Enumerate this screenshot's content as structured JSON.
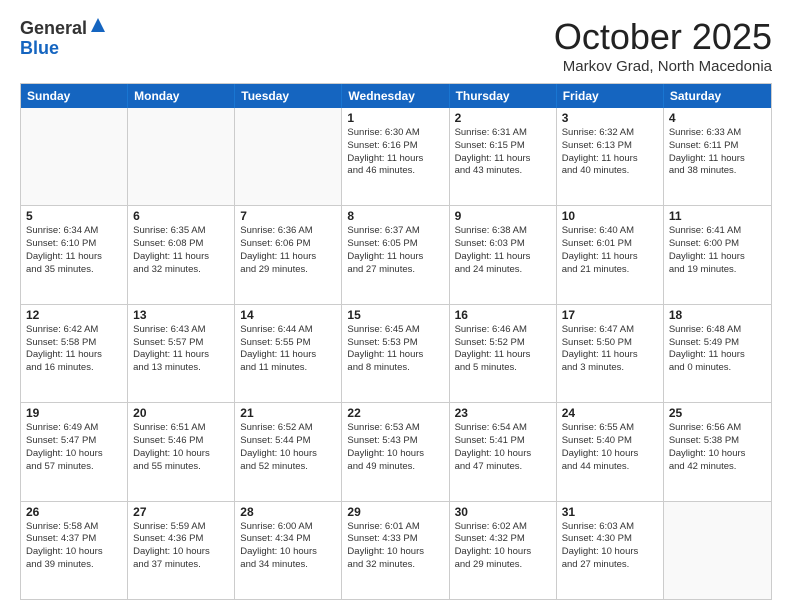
{
  "header": {
    "logo_general": "General",
    "logo_blue": "Blue",
    "month_title": "October 2025",
    "location": "Markov Grad, North Macedonia"
  },
  "weekdays": [
    "Sunday",
    "Monday",
    "Tuesday",
    "Wednesday",
    "Thursday",
    "Friday",
    "Saturday"
  ],
  "rows": [
    [
      {
        "day": "",
        "lines": [],
        "empty": true
      },
      {
        "day": "",
        "lines": [],
        "empty": true
      },
      {
        "day": "",
        "lines": [],
        "empty": true
      },
      {
        "day": "1",
        "lines": [
          "Sunrise: 6:30 AM",
          "Sunset: 6:16 PM",
          "Daylight: 11 hours",
          "and 46 minutes."
        ]
      },
      {
        "day": "2",
        "lines": [
          "Sunrise: 6:31 AM",
          "Sunset: 6:15 PM",
          "Daylight: 11 hours",
          "and 43 minutes."
        ]
      },
      {
        "day": "3",
        "lines": [
          "Sunrise: 6:32 AM",
          "Sunset: 6:13 PM",
          "Daylight: 11 hours",
          "and 40 minutes."
        ]
      },
      {
        "day": "4",
        "lines": [
          "Sunrise: 6:33 AM",
          "Sunset: 6:11 PM",
          "Daylight: 11 hours",
          "and 38 minutes."
        ]
      }
    ],
    [
      {
        "day": "5",
        "lines": [
          "Sunrise: 6:34 AM",
          "Sunset: 6:10 PM",
          "Daylight: 11 hours",
          "and 35 minutes."
        ]
      },
      {
        "day": "6",
        "lines": [
          "Sunrise: 6:35 AM",
          "Sunset: 6:08 PM",
          "Daylight: 11 hours",
          "and 32 minutes."
        ]
      },
      {
        "day": "7",
        "lines": [
          "Sunrise: 6:36 AM",
          "Sunset: 6:06 PM",
          "Daylight: 11 hours",
          "and 29 minutes."
        ]
      },
      {
        "day": "8",
        "lines": [
          "Sunrise: 6:37 AM",
          "Sunset: 6:05 PM",
          "Daylight: 11 hours",
          "and 27 minutes."
        ]
      },
      {
        "day": "9",
        "lines": [
          "Sunrise: 6:38 AM",
          "Sunset: 6:03 PM",
          "Daylight: 11 hours",
          "and 24 minutes."
        ]
      },
      {
        "day": "10",
        "lines": [
          "Sunrise: 6:40 AM",
          "Sunset: 6:01 PM",
          "Daylight: 11 hours",
          "and 21 minutes."
        ]
      },
      {
        "day": "11",
        "lines": [
          "Sunrise: 6:41 AM",
          "Sunset: 6:00 PM",
          "Daylight: 11 hours",
          "and 19 minutes."
        ]
      }
    ],
    [
      {
        "day": "12",
        "lines": [
          "Sunrise: 6:42 AM",
          "Sunset: 5:58 PM",
          "Daylight: 11 hours",
          "and 16 minutes."
        ]
      },
      {
        "day": "13",
        "lines": [
          "Sunrise: 6:43 AM",
          "Sunset: 5:57 PM",
          "Daylight: 11 hours",
          "and 13 minutes."
        ]
      },
      {
        "day": "14",
        "lines": [
          "Sunrise: 6:44 AM",
          "Sunset: 5:55 PM",
          "Daylight: 11 hours",
          "and 11 minutes."
        ]
      },
      {
        "day": "15",
        "lines": [
          "Sunrise: 6:45 AM",
          "Sunset: 5:53 PM",
          "Daylight: 11 hours",
          "and 8 minutes."
        ]
      },
      {
        "day": "16",
        "lines": [
          "Sunrise: 6:46 AM",
          "Sunset: 5:52 PM",
          "Daylight: 11 hours",
          "and 5 minutes."
        ]
      },
      {
        "day": "17",
        "lines": [
          "Sunrise: 6:47 AM",
          "Sunset: 5:50 PM",
          "Daylight: 11 hours",
          "and 3 minutes."
        ]
      },
      {
        "day": "18",
        "lines": [
          "Sunrise: 6:48 AM",
          "Sunset: 5:49 PM",
          "Daylight: 11 hours",
          "and 0 minutes."
        ]
      }
    ],
    [
      {
        "day": "19",
        "lines": [
          "Sunrise: 6:49 AM",
          "Sunset: 5:47 PM",
          "Daylight: 10 hours",
          "and 57 minutes."
        ]
      },
      {
        "day": "20",
        "lines": [
          "Sunrise: 6:51 AM",
          "Sunset: 5:46 PM",
          "Daylight: 10 hours",
          "and 55 minutes."
        ]
      },
      {
        "day": "21",
        "lines": [
          "Sunrise: 6:52 AM",
          "Sunset: 5:44 PM",
          "Daylight: 10 hours",
          "and 52 minutes."
        ]
      },
      {
        "day": "22",
        "lines": [
          "Sunrise: 6:53 AM",
          "Sunset: 5:43 PM",
          "Daylight: 10 hours",
          "and 49 minutes."
        ]
      },
      {
        "day": "23",
        "lines": [
          "Sunrise: 6:54 AM",
          "Sunset: 5:41 PM",
          "Daylight: 10 hours",
          "and 47 minutes."
        ]
      },
      {
        "day": "24",
        "lines": [
          "Sunrise: 6:55 AM",
          "Sunset: 5:40 PM",
          "Daylight: 10 hours",
          "and 44 minutes."
        ]
      },
      {
        "day": "25",
        "lines": [
          "Sunrise: 6:56 AM",
          "Sunset: 5:38 PM",
          "Daylight: 10 hours",
          "and 42 minutes."
        ]
      }
    ],
    [
      {
        "day": "26",
        "lines": [
          "Sunrise: 5:58 AM",
          "Sunset: 4:37 PM",
          "Daylight: 10 hours",
          "and 39 minutes."
        ]
      },
      {
        "day": "27",
        "lines": [
          "Sunrise: 5:59 AM",
          "Sunset: 4:36 PM",
          "Daylight: 10 hours",
          "and 37 minutes."
        ]
      },
      {
        "day": "28",
        "lines": [
          "Sunrise: 6:00 AM",
          "Sunset: 4:34 PM",
          "Daylight: 10 hours",
          "and 34 minutes."
        ]
      },
      {
        "day": "29",
        "lines": [
          "Sunrise: 6:01 AM",
          "Sunset: 4:33 PM",
          "Daylight: 10 hours",
          "and 32 minutes."
        ]
      },
      {
        "day": "30",
        "lines": [
          "Sunrise: 6:02 AM",
          "Sunset: 4:32 PM",
          "Daylight: 10 hours",
          "and 29 minutes."
        ]
      },
      {
        "day": "31",
        "lines": [
          "Sunrise: 6:03 AM",
          "Sunset: 4:30 PM",
          "Daylight: 10 hours",
          "and 27 minutes."
        ]
      },
      {
        "day": "",
        "lines": [],
        "empty": true
      }
    ]
  ]
}
